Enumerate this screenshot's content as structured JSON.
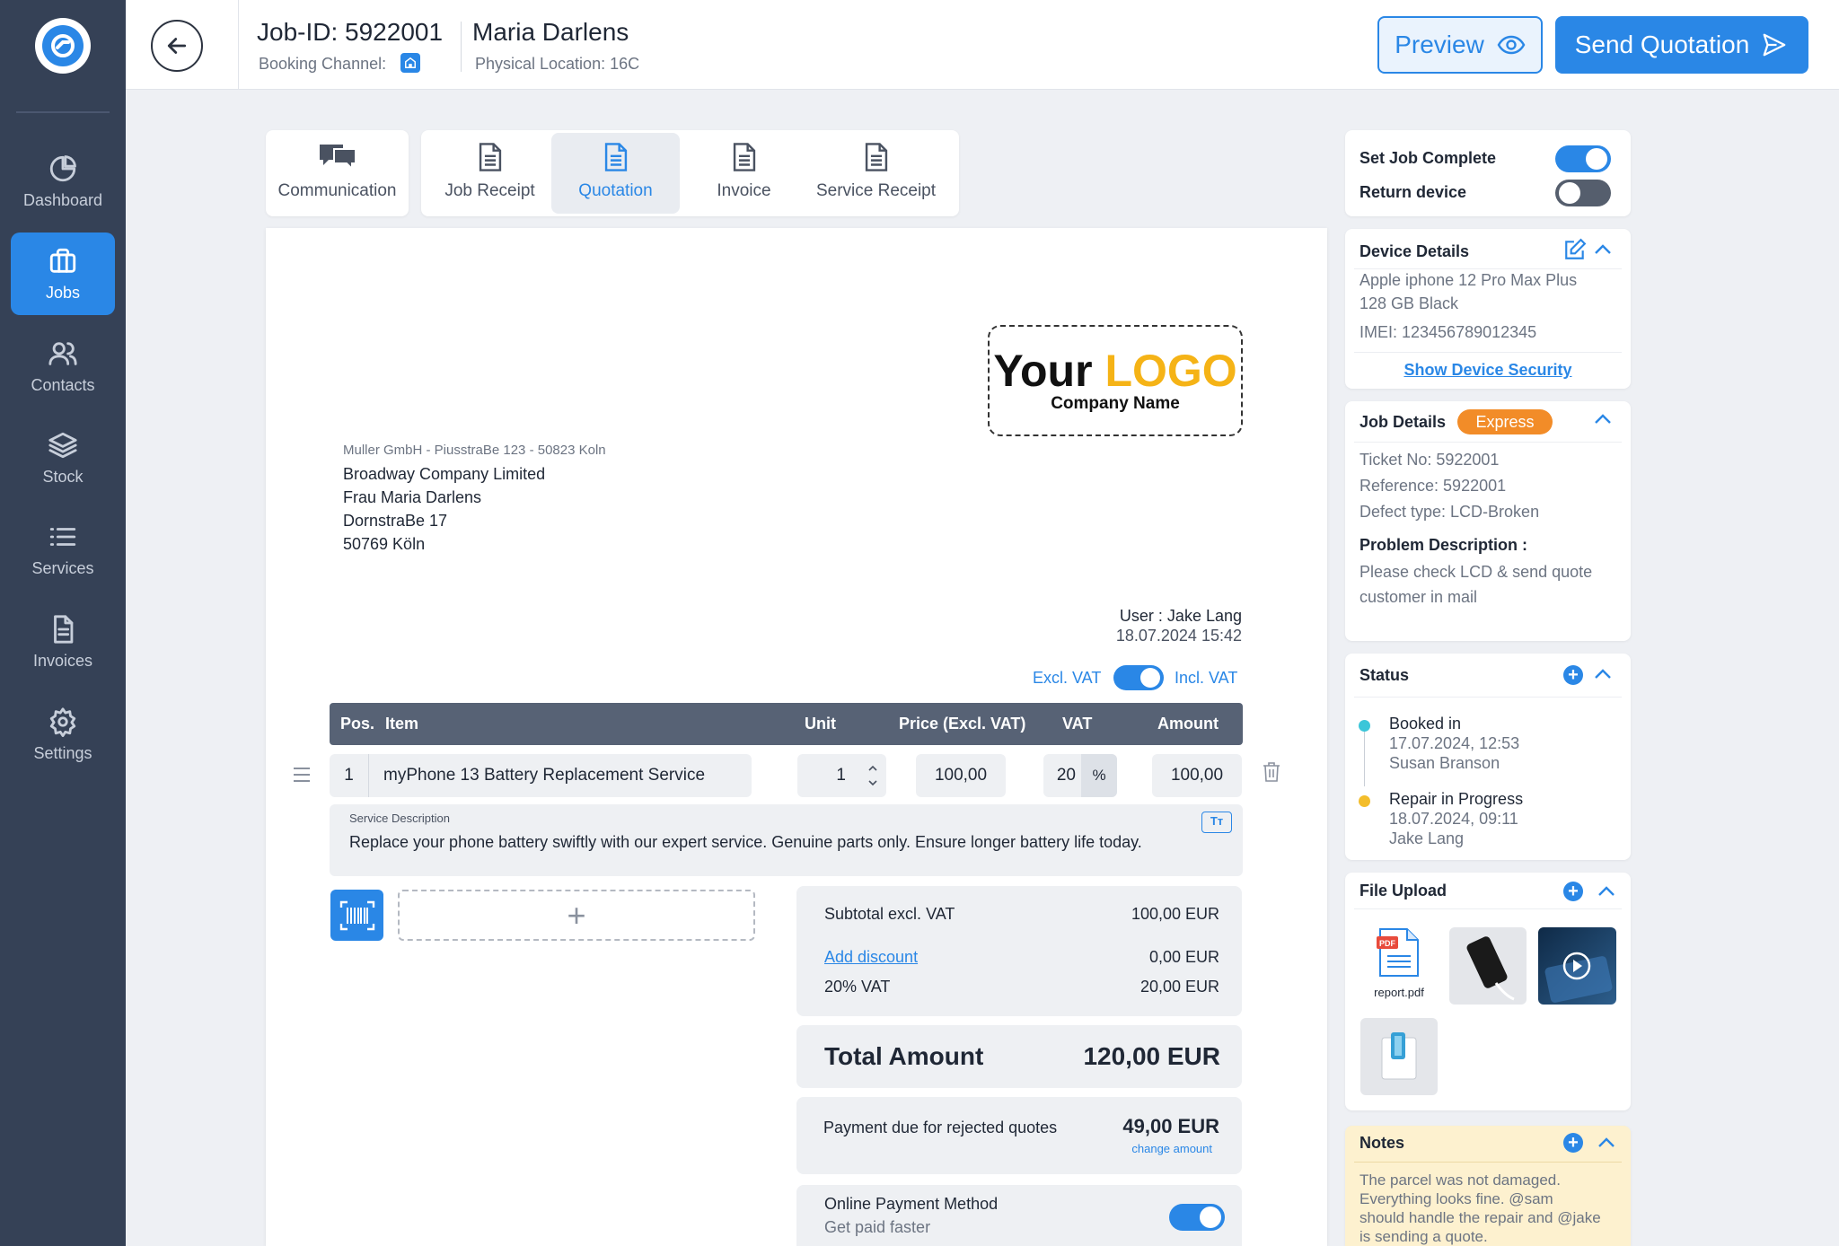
{
  "sidebar": {
    "items": [
      {
        "label": "Dashboard",
        "icon": "pie-chart-icon"
      },
      {
        "label": "Jobs",
        "icon": "briefcase-icon"
      },
      {
        "label": "Contacts",
        "icon": "users-icon"
      },
      {
        "label": "Stock",
        "icon": "layers-icon"
      },
      {
        "label": "Services",
        "icon": "list-icon"
      },
      {
        "label": "Invoices",
        "icon": "document-icon"
      },
      {
        "label": "Settings",
        "icon": "gear-icon"
      }
    ],
    "active": "Jobs"
  },
  "header": {
    "job_id": "Job-ID: 5922001",
    "booking_channel": "Booking Channel:",
    "customer": "Maria Darlens",
    "physical_location": "Physical Location: 16C",
    "preview_label": "Preview",
    "send_label": "Send Quotation"
  },
  "tabs": [
    {
      "label": "Communication"
    },
    {
      "label": "Job Receipt"
    },
    {
      "label": "Quotation"
    },
    {
      "label": "Invoice"
    },
    {
      "label": "Service Receipt"
    }
  ],
  "active_tab": "Quotation",
  "document": {
    "logo_your": "Your",
    "logo_logo": "LOGO",
    "logo_company": "Company Name",
    "sender_line": "Muller GmbH - PiusstraBe 123 - 50823 Koln",
    "recipient": [
      "Broadway Company Limited",
      "Frau Maria Darlens",
      "DornstraBe  17",
      "50769 Köln"
    ],
    "user": "User : Jake Lang",
    "datetime": "18.07.2024 15:42",
    "excl_vat": "Excl. VAT",
    "incl_vat": "Incl. VAT",
    "vat_toggle_on": true,
    "columns": {
      "pos": "Pos.",
      "item": "Item",
      "unit": "Unit",
      "price": "Price (Excl. VAT)",
      "vat": "VAT",
      "amount": "Amount"
    },
    "line_item": {
      "pos": "1",
      "item": "myPhone 13 Battery Replacement Service",
      "unit": "1",
      "price": "100,00",
      "vat": "20",
      "vat_unit": "%",
      "amount": "100,00",
      "desc_label": "Service Description",
      "desc_text": "Replace your phone battery swiftly with our expert service. Genuine parts only. Ensure longer battery life today."
    },
    "add_symbol": "+",
    "subtotal_label": "Subtotal excl. VAT",
    "subtotal_value": "100,00 EUR",
    "discount_label": "Add discount",
    "discount_value": "0,00 EUR",
    "vat_label": "20% VAT",
    "vat_value": "20,00 EUR",
    "total_label": "Total Amount",
    "total_value": "120,00 EUR",
    "rejected_label": "Payment due for rejected quotes",
    "rejected_value": "49,00 EUR",
    "change_amount": "change amount",
    "online_title": "Online Payment Method",
    "online_sub": "Get paid faster",
    "online_on": true
  },
  "right": {
    "set_job_complete": "Set Job Complete",
    "set_job_complete_on": true,
    "return_device": "Return device",
    "return_device_on": false,
    "device_details": {
      "title": "Device Details",
      "line1": "Apple iphone 12 Pro Max Plus",
      "line2": "128 GB Black",
      "imei": "IMEI: 123456789012345",
      "link": "Show Device Security"
    },
    "job_details": {
      "title": "Job Details",
      "badge": "Express",
      "ticket": "Ticket No: 5922001",
      "reference": "Reference: 5922001",
      "defect": "Defect type: LCD-Broken",
      "problem_label": "Problem Description :",
      "problem_text": "Please check LCD & send quote customer in mail"
    },
    "status": {
      "title": "Status",
      "entries": [
        {
          "name": "Booked in",
          "date": "17.07.2024, 12:53",
          "person": "Susan Branson",
          "color": "#3cc6d9"
        },
        {
          "name": "Repair in Progress",
          "date": "18.07.2024, 09:11",
          "person": "Jake Lang",
          "color": "#f3bd2b"
        }
      ]
    },
    "file_upload": {
      "title": "File Upload",
      "file_name": "report.pdf"
    },
    "notes": {
      "title": "Notes",
      "text": "The parcel was not damaged. Everything looks fine. @sam should handle the repair and @jake is sending a quote."
    }
  },
  "colors": {
    "accent": "#2a87e6",
    "sidebar": "#354156",
    "express": "#f28c28",
    "notes_bg": "#fdf1cf"
  }
}
